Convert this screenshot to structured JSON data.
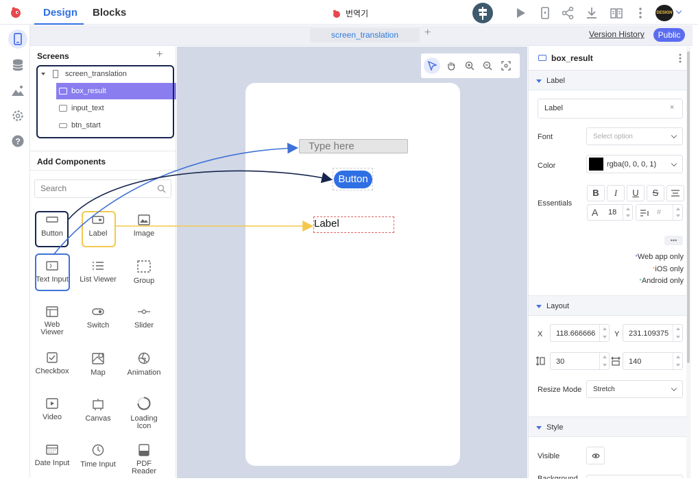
{
  "topbar": {
    "design_tab": "Design",
    "blocks_tab": "Blocks",
    "project_title": "번역기",
    "avatar_text": "DESIGN",
    "accent_color": "#2f6fe4"
  },
  "subbar": {
    "screen_tab": "screen_translation",
    "add_tab": "+",
    "version_history": "Version History",
    "public_button": "Public"
  },
  "screens_panel": {
    "title": "Screens",
    "add": "+",
    "tree": [
      {
        "label": "screen_translation",
        "icon": "phone-icon"
      },
      {
        "label": "box_result",
        "icon": "label-component-icon"
      },
      {
        "label": "input_text",
        "icon": "text-input-component-icon"
      },
      {
        "label": "btn_start",
        "icon": "button-component-icon"
      }
    ]
  },
  "components_panel": {
    "title": "Add Components",
    "search_placeholder": "Search",
    "items": [
      {
        "label": "Button"
      },
      {
        "label": "Label"
      },
      {
        "label": "Image"
      },
      {
        "label": "Text Input"
      },
      {
        "label": "List Viewer"
      },
      {
        "label": "Group"
      },
      {
        "label": "Web Viewer"
      },
      {
        "label": "Switch"
      },
      {
        "label": "Slider"
      },
      {
        "label": "Checkbox"
      },
      {
        "label": "Map"
      },
      {
        "label": "Animation"
      },
      {
        "label": "Video"
      },
      {
        "label": "Canvas"
      },
      {
        "label": "Loading Icon"
      },
      {
        "label": "Date Input"
      },
      {
        "label": "Time Input"
      },
      {
        "label": "PDF Reader"
      }
    ]
  },
  "canvas": {
    "input_placeholder": "Type here",
    "button_label": "Button",
    "label_text": "Label"
  },
  "properties": {
    "component_name": "box_result",
    "section_label": "Label",
    "label_value": "Label",
    "clear": "×",
    "font_label": "Font",
    "font_placeholder": "Select option",
    "color_label": "Color",
    "color_value": "rgba(0, 0, 0, 1)",
    "essentials_label": "Essentials",
    "essentials_buttons": [
      "B",
      "I",
      "U",
      "S"
    ],
    "font_size_icon": "A",
    "font_size": "18",
    "line_height_placeholder": "#",
    "more": "•••",
    "notes": [
      {
        "bullet": "*",
        "text": "Web app only",
        "color": "#5b6cf0"
      },
      {
        "bullet": "*",
        "text": "iOS only",
        "color": "#f0a35b"
      },
      {
        "bullet": "*",
        "text": "Android only",
        "color": "#3cbf74"
      }
    ],
    "layout_section": "Layout",
    "x_label": "X",
    "x_value": "118.666666",
    "y_label": "Y",
    "y_value": "231.109375",
    "height_value": "30",
    "width_value": "140",
    "resize_label": "Resize Mode",
    "resize_value": "Stretch",
    "style_section": "Style",
    "visible_label": "Visible",
    "background_label": "Background"
  }
}
